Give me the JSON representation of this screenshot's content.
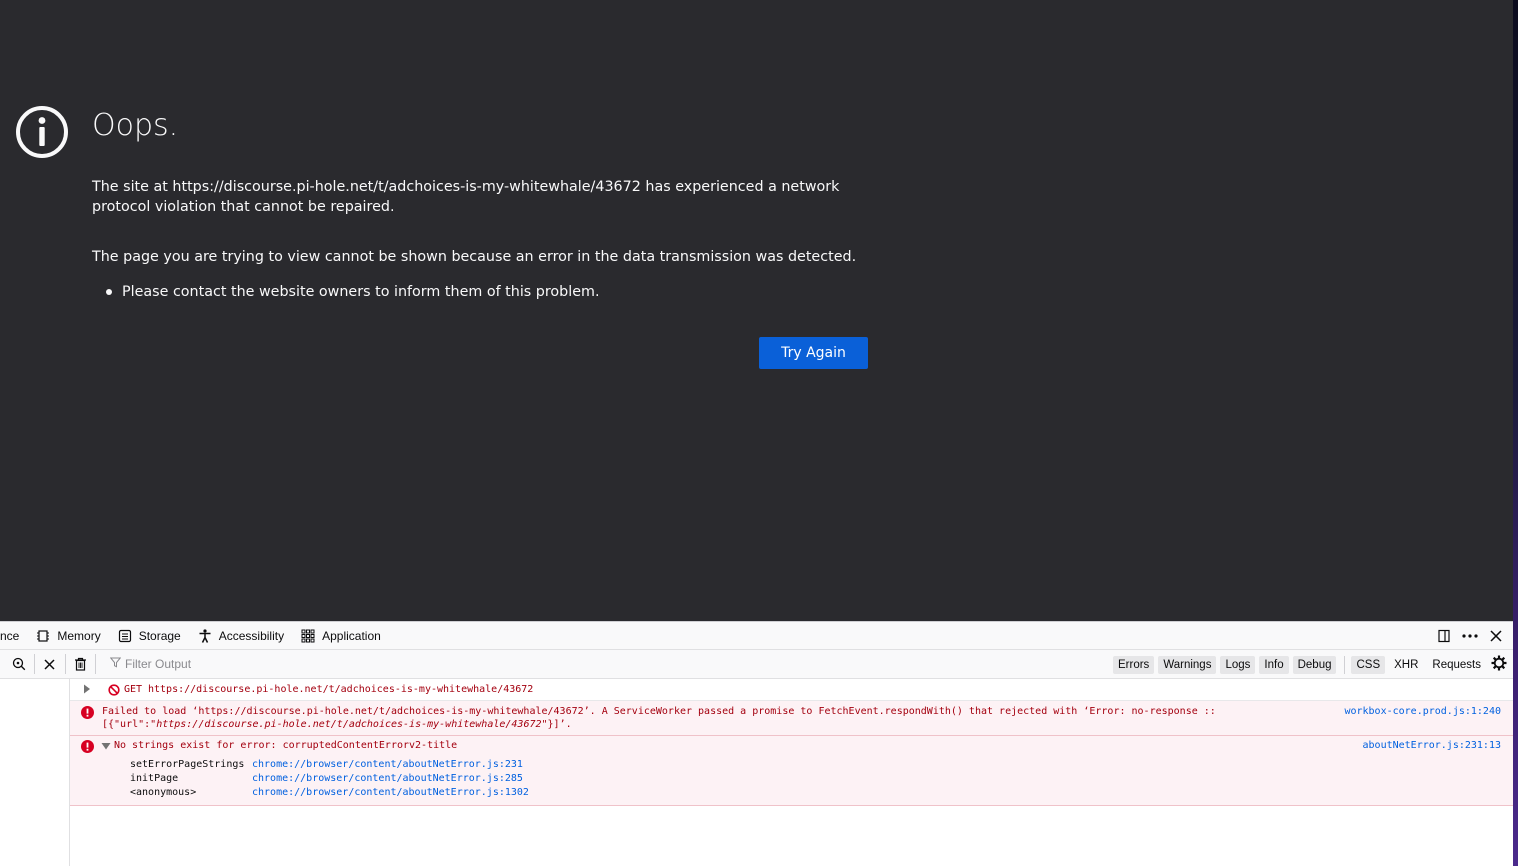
{
  "error_page": {
    "title": "Oops.",
    "description": "The site at https://discourse.pi-hole.net/t/adchoices-is-my-whitewhale/43672 has experienced a network protocol violation that cannot be repaired.",
    "long_description": "The page you are trying to view cannot be shown because an error in the data transmission was detected.",
    "bullet": "Please contact the website owners to inform them of this problem.",
    "try_again_label": "Try Again",
    "accent_color": "#0a60d8",
    "background_color": "#2a2a2e"
  },
  "devtools": {
    "tabs": [
      {
        "label": "nce",
        "icon": "performance-icon"
      },
      {
        "label": "Memory",
        "icon": "memory-icon"
      },
      {
        "label": "Storage",
        "icon": "storage-icon"
      },
      {
        "label": "Accessibility",
        "icon": "accessibility-icon"
      },
      {
        "label": "Application",
        "icon": "application-grid-icon"
      }
    ],
    "actions": [
      "dock-side-icon",
      "more-options-icon",
      "close-icon"
    ],
    "toolbar": {
      "filter_placeholder": "Filter Output",
      "levels": [
        "Errors",
        "Warnings",
        "Logs",
        "Info",
        "Debug"
      ],
      "types": [
        "CSS",
        "XHR",
        "Requests"
      ]
    },
    "messages": {
      "network": {
        "method": "GET",
        "url": "https://discourse.pi-hole.net/t/adchoices-is-my-whitewhale/43672"
      },
      "service_worker": {
        "line1": "Failed to load ‘https://discourse.pi-hole.net/t/adchoices-is-my-whitewhale/43672’. A ServiceWorker passed a promise to FetchEvent.respondWith() that rejected with ‘Error: no-response ::",
        "line2_prefix": "[{\"url\":\"",
        "line2_url": "https://discourse.pi-hole.net/t/adchoices-is-my-whitewhale/43672",
        "line2_suffix": "\"}]’.",
        "source": "workbox-core.prod.js:1:240"
      },
      "missing_string": {
        "text": "No strings exist for error: corruptedContentErrorv2-title",
        "source": "aboutNetError.js:231:13",
        "stack": [
          {
            "fn": "setErrorPageStrings",
            "link": "chrome://browser/content/aboutNetError.js:231"
          },
          {
            "fn": "initPage",
            "link": "chrome://browser/content/aboutNetError.js:285"
          },
          {
            "fn": "<anonymous>",
            "link": "chrome://browser/content/aboutNetError.js:1302"
          }
        ]
      }
    }
  }
}
